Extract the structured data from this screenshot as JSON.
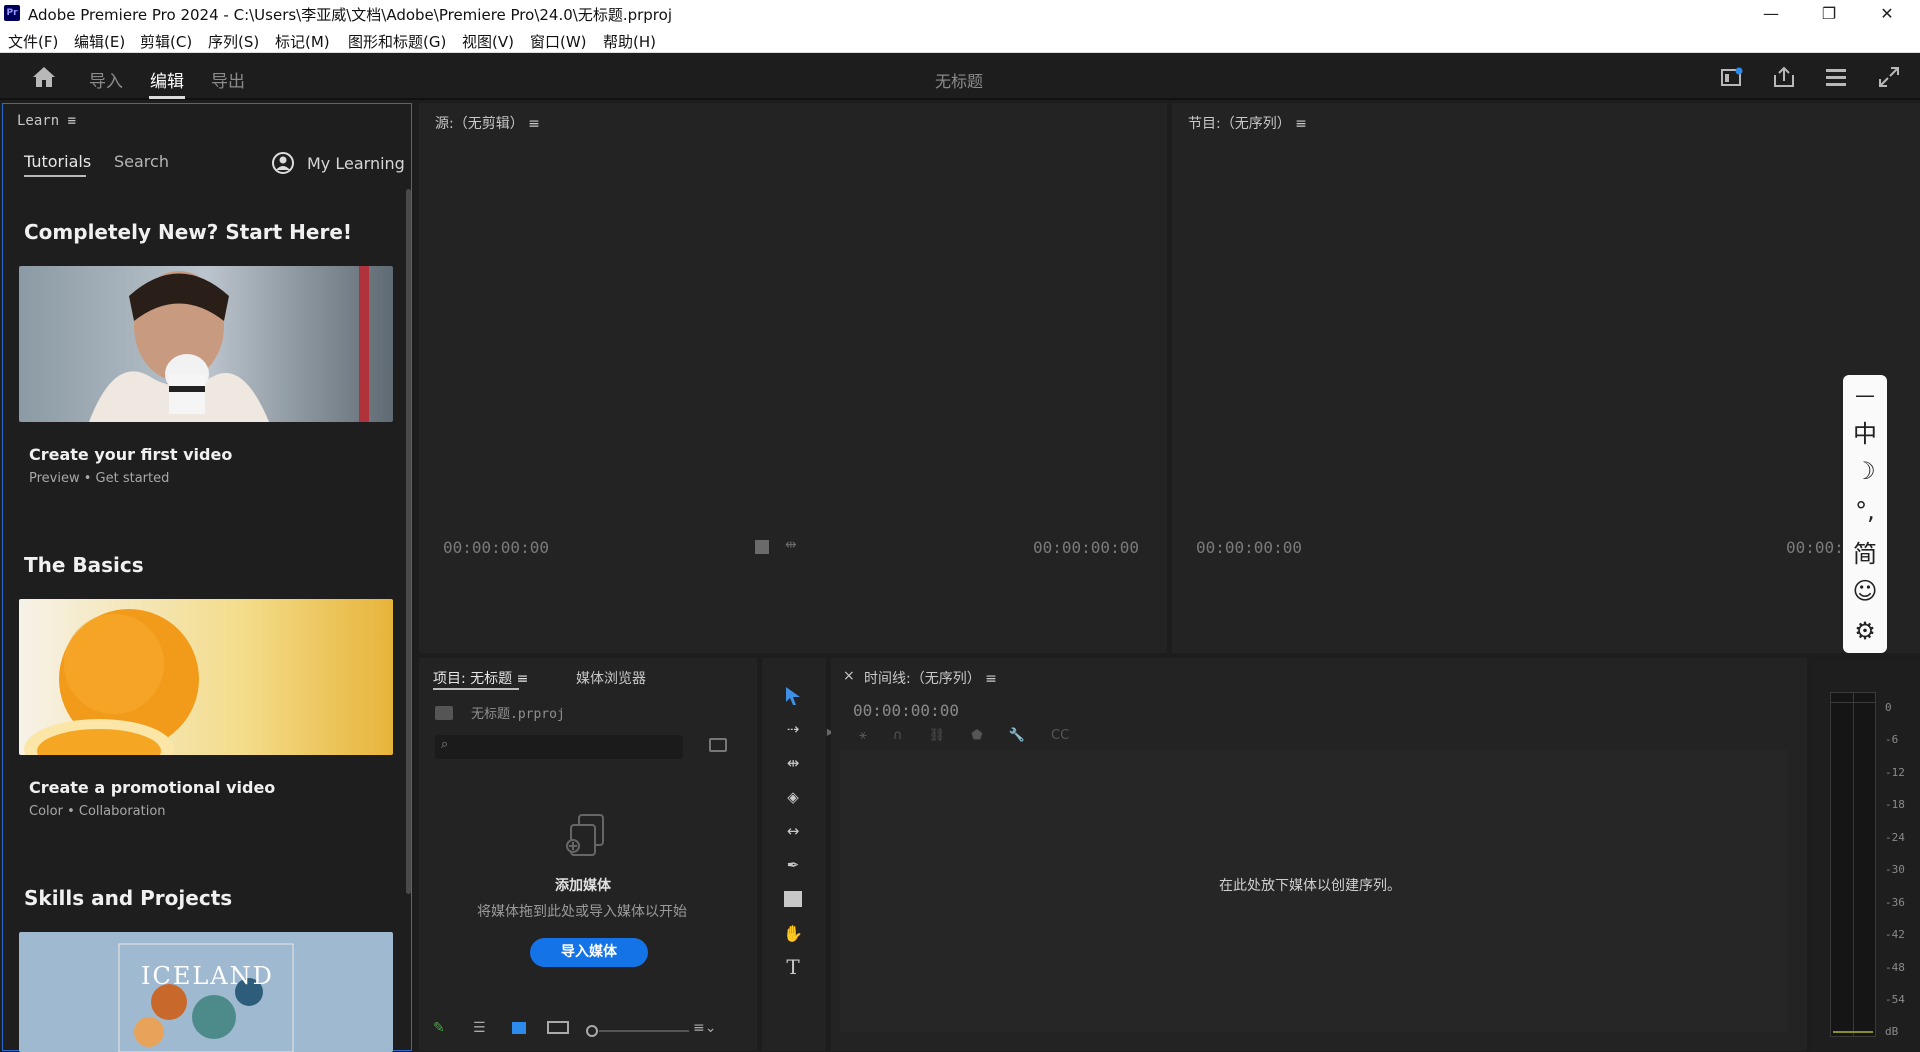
{
  "app": {
    "logo": "Pr",
    "window_title": "Adobe Premiere Pro 2024 - C:\\Users\\李亚威\\文档\\Adobe\\Premiere Pro\\24.0\\无标题.prproj",
    "document_title": "无标题"
  },
  "window_controls": {
    "minimize": "—",
    "restore": "❐",
    "close": "✕"
  },
  "menu": [
    "文件(F)",
    "编辑(E)",
    "剪辑(C)",
    "序列(S)",
    "标记(M)",
    "图形和标题(G)",
    "视图(V)",
    "窗口(W)",
    "帮助(H)"
  ],
  "workspaces": {
    "import": "导入",
    "edit": "编辑",
    "export": "导出"
  },
  "learn": {
    "title": "Learn",
    "tabs": [
      "Tutorials",
      "Search"
    ],
    "my_learning": "My Learning",
    "sections": [
      {
        "title": "Completely New? Start Here!",
        "card_title": "Create your first video",
        "tags": [
          "Preview",
          "Get started"
        ]
      },
      {
        "title": "The Basics",
        "card_title": "Create a promotional video",
        "tags": [
          "Color",
          "Collaboration"
        ]
      },
      {
        "title": "Skills and Projects",
        "card_overlay": "ICELAND"
      }
    ]
  },
  "source_monitor": {
    "title": "源:（无剪辑）",
    "timecode_left": "00:00:00:00",
    "timecode_right": "00:00:00:00"
  },
  "program_monitor": {
    "title": "节目:（无序列）",
    "timecode_left": "00:00:00:00",
    "timecode_right": "00:00:"
  },
  "project": {
    "tab_project": "项目: 无标题",
    "tab_media": "媒体浏览器",
    "file": "无标题.prproj",
    "empty_title": "添加媒体",
    "empty_desc": "将媒体拖到此处或导入媒体以开始",
    "import_button": "导入媒体"
  },
  "timeline": {
    "title": "时间线:（无序列）",
    "close": "×",
    "timecode": "00:00:00:00",
    "drop_hint": "在此处放下媒体以创建序列。"
  },
  "meter": {
    "levels": [
      "0",
      "-6",
      "-12",
      "-18",
      "-24",
      "-30",
      "-36",
      "-42",
      "-48",
      "-54",
      "dB"
    ]
  },
  "ime": {
    "keys": [
      "中",
      "☽",
      "°,",
      "简",
      "☺",
      "⚙"
    ]
  },
  "colors": {
    "accent": "#1473e6",
    "panel": "#232323",
    "bg": "#1d1d1d",
    "focus": "#2b6bcc"
  }
}
